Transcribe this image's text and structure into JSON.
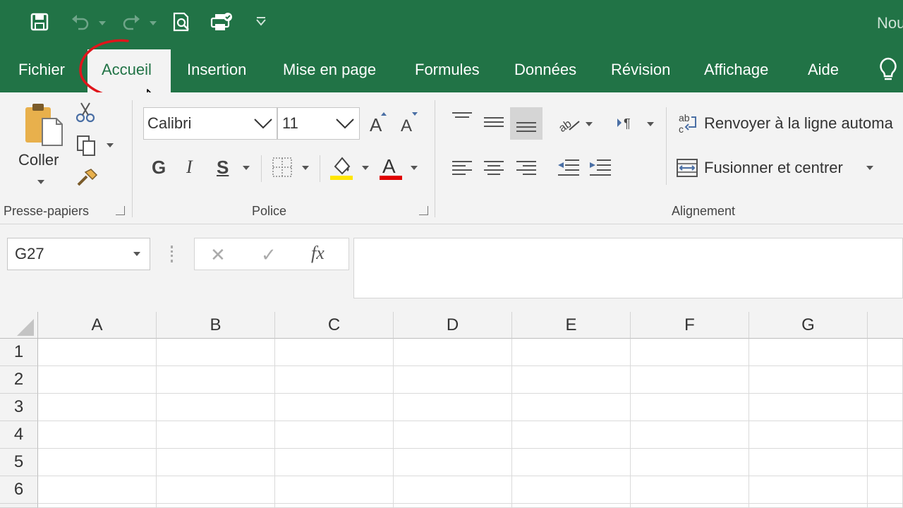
{
  "quick_access": {
    "icons": [
      "save-icon",
      "undo-icon",
      "redo-icon",
      "print-preview-icon",
      "touch-mode-icon",
      "customize-qat-icon"
    ]
  },
  "title": {
    "text": "Nou"
  },
  "tabs": [
    "Fichier",
    "Accueil",
    "Insertion",
    "Mise en page",
    "Formules",
    "Données",
    "Révision",
    "Affichage",
    "Aide"
  ],
  "ribbon": {
    "clipboard": {
      "paste_label": "Coller",
      "group_label": "Presse-papiers"
    },
    "font": {
      "font_name": "Calibri",
      "font_size": "11",
      "bold": "G",
      "italic": "I",
      "underline": "S",
      "group_label": "Police",
      "fill_color": "#ffe600",
      "font_color": "#e00000"
    },
    "alignment": {
      "wrap_text": "Renvoyer à la ligne automa",
      "merge_center": "Fusionner et centrer",
      "group_label": "Alignement"
    }
  },
  "formula_bar": {
    "name_box": "G27",
    "cancel_symbol": "✕",
    "enter_symbol": "✓",
    "function_symbol": "fx",
    "content": ""
  },
  "sheet": {
    "columns": [
      "A",
      "B",
      "C",
      "D",
      "E",
      "F",
      "G"
    ],
    "rows": [
      "1",
      "2",
      "3",
      "4",
      "5",
      "6"
    ]
  },
  "colors": {
    "brand_green": "#217346",
    "annotation_red": "#e0151b"
  }
}
